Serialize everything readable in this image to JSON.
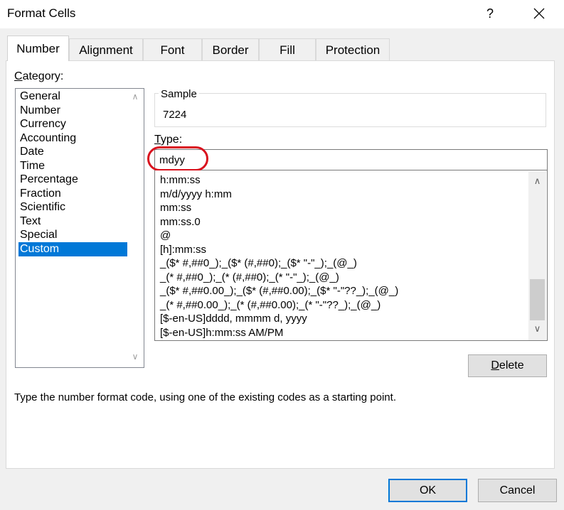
{
  "window": {
    "title": "Format Cells",
    "help_label": "?"
  },
  "tabs": [
    {
      "label": "Number"
    },
    {
      "label": "Alignment"
    },
    {
      "label": "Font"
    },
    {
      "label": "Border"
    },
    {
      "label": "Fill"
    },
    {
      "label": "Protection"
    }
  ],
  "category": {
    "label_first": "C",
    "label_rest": "ategory:",
    "items": [
      "General",
      "Number",
      "Currency",
      "Accounting",
      "Date",
      "Time",
      "Percentage",
      "Fraction",
      "Scientific",
      "Text",
      "Special",
      "Custom"
    ],
    "selected": "Custom"
  },
  "sample": {
    "label": "Sample",
    "value": "7224"
  },
  "type": {
    "label_first": "T",
    "label_rest": "ype:",
    "value": "mdyy"
  },
  "formats": [
    "h:mm:ss",
    "m/d/yyyy h:mm",
    "mm:ss",
    "mm:ss.0",
    "@",
    "[h]:mm:ss",
    "_($* #,##0_);_($* (#,##0);_($* \"-\"_);_(@_)",
    "_(* #,##0_);_(* (#,##0);_(* \"-\"_);_(@_)",
    "_($* #,##0.00_);_($* (#,##0.00);_($* \"-\"??_);_(@_)",
    "_(* #,##0.00_);_(* (#,##0.00);_(* \"-\"??_);_(@_)",
    "[$-en-US]dddd, mmmm d, yyyy",
    "[$-en-US]h:mm:ss AM/PM"
  ],
  "buttons": {
    "delete_first": "D",
    "delete_rest": "elete",
    "ok": "OK",
    "cancel": "Cancel"
  },
  "hint": "Type the number format code, using one of the existing codes as a starting point.",
  "colors": {
    "selection": "#0078d7",
    "highlight_ring": "#d9121e"
  }
}
